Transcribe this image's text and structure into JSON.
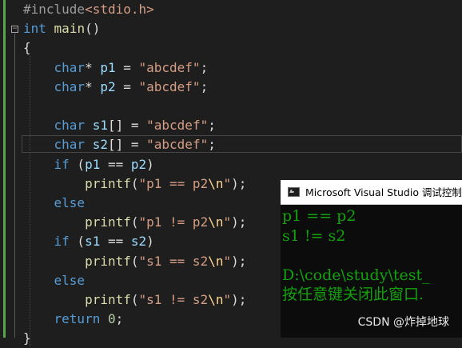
{
  "editor": {
    "lines": [
      {
        "tokens": [
          {
            "t": "#include",
            "c": "pp"
          },
          {
            "t": "<stdio.h>",
            "c": "inc"
          }
        ]
      },
      {
        "tokens": [
          {
            "t": "int",
            "c": "kw"
          },
          {
            "t": " ",
            "c": "plain"
          },
          {
            "t": "main",
            "c": "fn"
          },
          {
            "t": "()",
            "c": "plain"
          }
        ]
      },
      {
        "tokens": [
          {
            "t": "{",
            "c": "plain"
          }
        ]
      },
      {
        "tokens": [
          {
            "t": "    ",
            "c": "plain"
          },
          {
            "t": "char",
            "c": "kw"
          },
          {
            "t": "* ",
            "c": "plain"
          },
          {
            "t": "p1",
            "c": "var"
          },
          {
            "t": " = ",
            "c": "plain"
          },
          {
            "t": "\"abcdef\"",
            "c": "str"
          },
          {
            "t": ";",
            "c": "plain"
          }
        ]
      },
      {
        "tokens": [
          {
            "t": "    ",
            "c": "plain"
          },
          {
            "t": "char",
            "c": "kw"
          },
          {
            "t": "* ",
            "c": "plain"
          },
          {
            "t": "p2",
            "c": "var"
          },
          {
            "t": " = ",
            "c": "plain"
          },
          {
            "t": "\"abcdef\"",
            "c": "str"
          },
          {
            "t": ";",
            "c": "plain"
          }
        ]
      },
      {
        "tokens": []
      },
      {
        "tokens": [
          {
            "t": "    ",
            "c": "plain"
          },
          {
            "t": "char",
            "c": "kw"
          },
          {
            "t": " ",
            "c": "plain"
          },
          {
            "t": "s1",
            "c": "var"
          },
          {
            "t": "[] = ",
            "c": "plain"
          },
          {
            "t": "\"abcdef\"",
            "c": "str"
          },
          {
            "t": ";",
            "c": "plain"
          }
        ]
      },
      {
        "tokens": [
          {
            "t": "    ",
            "c": "plain"
          },
          {
            "t": "char",
            "c": "kw"
          },
          {
            "t": " ",
            "c": "plain"
          },
          {
            "t": "s2",
            "c": "var"
          },
          {
            "t": "[] = ",
            "c": "plain"
          },
          {
            "t": "\"abcdef\"",
            "c": "str"
          },
          {
            "t": ";",
            "c": "plain"
          }
        ]
      },
      {
        "tokens": [
          {
            "t": "    ",
            "c": "plain"
          },
          {
            "t": "if",
            "c": "kw"
          },
          {
            "t": " (",
            "c": "plain"
          },
          {
            "t": "p1",
            "c": "var"
          },
          {
            "t": " == ",
            "c": "plain"
          },
          {
            "t": "p2",
            "c": "var"
          },
          {
            "t": ")",
            "c": "plain"
          }
        ]
      },
      {
        "tokens": [
          {
            "t": "        ",
            "c": "plain"
          },
          {
            "t": "printf",
            "c": "fn"
          },
          {
            "t": "(",
            "c": "plain"
          },
          {
            "t": "\"p1 == p2",
            "c": "str"
          },
          {
            "t": "\\n",
            "c": "esc"
          },
          {
            "t": "\"",
            "c": "str"
          },
          {
            "t": ");",
            "c": "plain"
          }
        ]
      },
      {
        "tokens": [
          {
            "t": "    ",
            "c": "plain"
          },
          {
            "t": "else",
            "c": "kw"
          }
        ]
      },
      {
        "tokens": [
          {
            "t": "        ",
            "c": "plain"
          },
          {
            "t": "printf",
            "c": "fn"
          },
          {
            "t": "(",
            "c": "plain"
          },
          {
            "t": "\"p1 != p2",
            "c": "str"
          },
          {
            "t": "\\n",
            "c": "esc"
          },
          {
            "t": "\"",
            "c": "str"
          },
          {
            "t": ");",
            "c": "plain"
          }
        ]
      },
      {
        "tokens": [
          {
            "t": "    ",
            "c": "plain"
          },
          {
            "t": "if",
            "c": "kw"
          },
          {
            "t": " (",
            "c": "plain"
          },
          {
            "t": "s1",
            "c": "var"
          },
          {
            "t": " == ",
            "c": "plain"
          },
          {
            "t": "s2",
            "c": "var"
          },
          {
            "t": ")",
            "c": "plain"
          }
        ]
      },
      {
        "tokens": [
          {
            "t": "        ",
            "c": "plain"
          },
          {
            "t": "printf",
            "c": "fn"
          },
          {
            "t": "(",
            "c": "plain"
          },
          {
            "t": "\"s1 == s2",
            "c": "str"
          },
          {
            "t": "\\n",
            "c": "esc"
          },
          {
            "t": "\"",
            "c": "str"
          },
          {
            "t": ");",
            "c": "plain"
          }
        ]
      },
      {
        "tokens": [
          {
            "t": "    ",
            "c": "plain"
          },
          {
            "t": "else",
            "c": "kw"
          }
        ]
      },
      {
        "tokens": [
          {
            "t": "        ",
            "c": "plain"
          },
          {
            "t": "printf",
            "c": "fn"
          },
          {
            "t": "(",
            "c": "plain"
          },
          {
            "t": "\"s1 != s2",
            "c": "str"
          },
          {
            "t": "\\n",
            "c": "esc"
          },
          {
            "t": "\"",
            "c": "str"
          },
          {
            "t": ");",
            "c": "plain"
          }
        ]
      },
      {
        "tokens": [
          {
            "t": "    ",
            "c": "plain"
          },
          {
            "t": "return",
            "c": "kw"
          },
          {
            "t": " ",
            "c": "plain"
          },
          {
            "t": "0",
            "c": "num"
          },
          {
            "t": ";",
            "c": "plain"
          }
        ]
      },
      {
        "tokens": [
          {
            "t": "}",
            "c": "plain"
          }
        ]
      }
    ]
  },
  "console": {
    "icon": "console-app-icon",
    "title": "Microsoft Visual Studio 调试控制台",
    "lines": [
      "p1 == p2",
      "s1 != s2",
      "",
      "D:\\code\\study\\test_",
      "按任意键关闭此窗口."
    ]
  },
  "watermark": "CSDN @炸掉地球"
}
